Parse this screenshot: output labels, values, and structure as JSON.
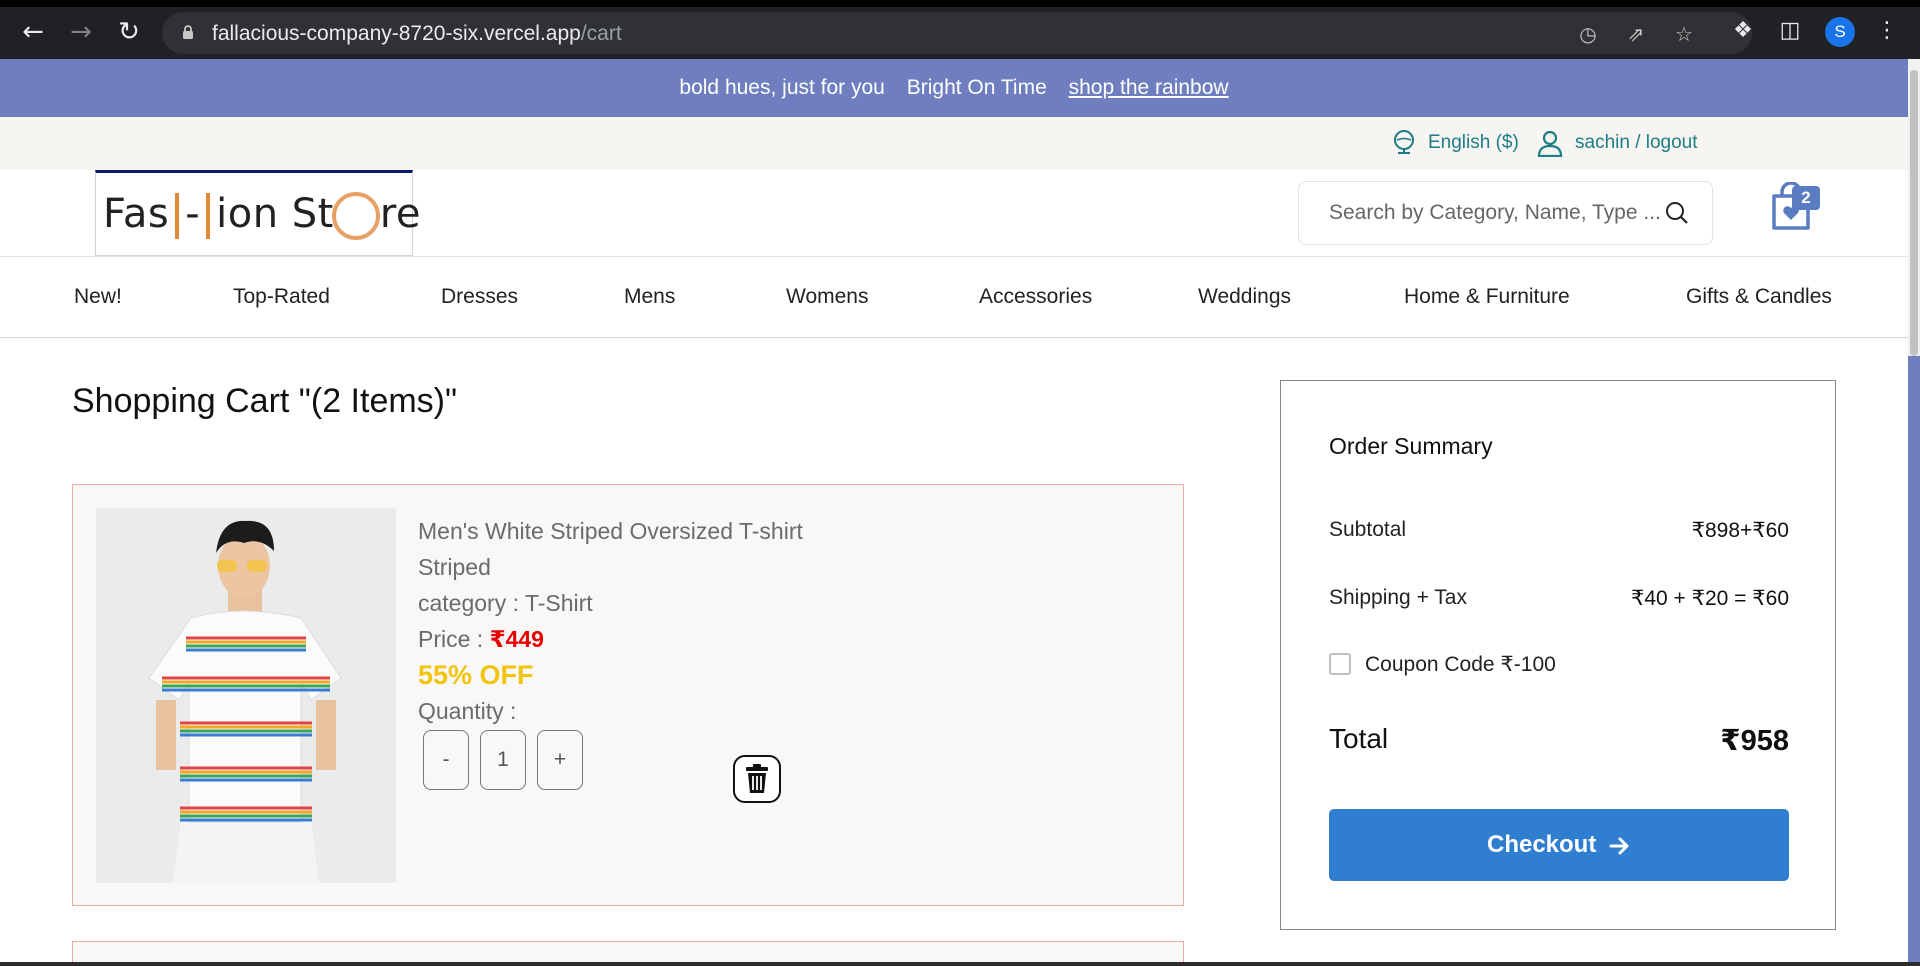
{
  "browser": {
    "url_host": "fallacious-company-8720-six.vercel.app",
    "url_path": "/cart",
    "profile_initial": "S"
  },
  "promo": {
    "text1": "bold hues, just for you",
    "text2": "Bright On Time",
    "link": "shop the rainbow"
  },
  "utility": {
    "language": "English ($)",
    "user": "sachin / logout"
  },
  "header": {
    "logo_part1": "Fas",
    "logo_part2": "-",
    "logo_part3": "ion St",
    "logo_part4": "re",
    "search_placeholder": "Search by Category, Name, Type ...",
    "cart_count": "2"
  },
  "categories": [
    "New!",
    "Top-Rated",
    "Dresses",
    "Mens",
    "Womens",
    "Accessories",
    "Weddings",
    "Home & Furniture",
    "Gifts & Candles"
  ],
  "cart": {
    "title": "Shopping Cart \"(2 Items)\"",
    "items": [
      {
        "name": "Men's White Striped Oversized T-shirt",
        "pattern": "Striped",
        "category_label": "category : T-Shirt",
        "price_label": "Price : ",
        "price": "₹449",
        "discount": "55% OFF",
        "quantity_label": "Quantity :",
        "quantity": "1",
        "minus": "-",
        "plus": "+"
      }
    ]
  },
  "summary": {
    "title": "Order Summary",
    "subtotal_label": "Subtotal",
    "subtotal_value": "₹898+₹60",
    "shipping_label": "Shipping + Tax",
    "shipping_value": "₹40 + ₹20 = ₹60",
    "coupon_label": "Coupon Code ₹-100",
    "total_label": "Total",
    "total_value": "₹958",
    "checkout_label": "Checkout"
  },
  "colors": {
    "promo_bg": "#6e7ebf",
    "accent_teal": "#1d7c86",
    "checkout_blue": "#2f7ed0",
    "price_red": "#e80000",
    "discount_yellow": "#f1c40f"
  }
}
